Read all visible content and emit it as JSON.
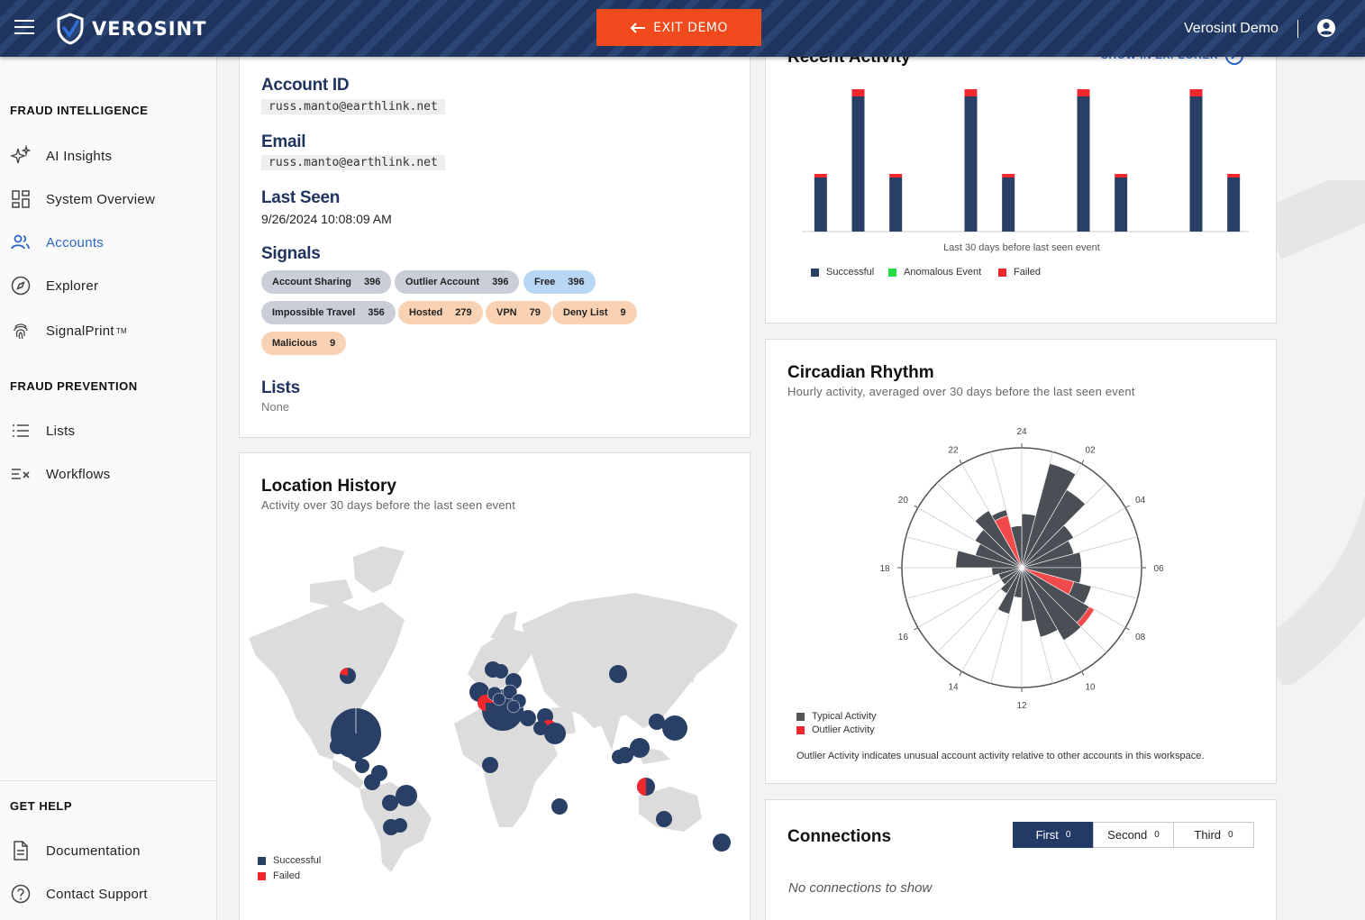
{
  "header": {
    "brand": "VEROSINT",
    "exit_label": "EXIT DEMO",
    "user_name": "Verosint Demo"
  },
  "sidebar": {
    "section_intel": "FRAUD INTELLIGENCE",
    "section_prevention": "FRAUD PREVENTION",
    "section_help": "GET HELP",
    "items": {
      "ai_insights": "AI Insights",
      "system_overview": "System Overview",
      "accounts": "Accounts",
      "explorer": "Explorer",
      "signalprint": "SignalPrint",
      "lists": "Lists",
      "workflows": "Workflows",
      "documentation": "Documentation",
      "contact_support": "Contact Support"
    },
    "trademark": "TM"
  },
  "account": {
    "account_id_label": "Account ID",
    "account_id": "russ.manto@earthlink.net",
    "email_label": "Email",
    "email": "russ.manto@earthlink.net",
    "last_seen_label": "Last Seen",
    "last_seen": "9/26/2024 10:08:09 AM",
    "signals_label": "Signals",
    "signals": [
      {
        "name": "Account Sharing",
        "count": "396"
      },
      {
        "name": "Outlier Account",
        "count": "396"
      },
      {
        "name": "Free",
        "count": "396"
      },
      {
        "name": "Impossible Travel",
        "count": "356"
      },
      {
        "name": "Hosted",
        "count": "279"
      },
      {
        "name": "VPN",
        "count": "79"
      },
      {
        "name": "Deny List",
        "count": "9"
      },
      {
        "name": "Malicious",
        "count": "9"
      }
    ],
    "lists_label": "Lists",
    "lists_value": "None"
  },
  "location": {
    "title": "Location History",
    "subtitle": "Activity over 30 days before the last seen event",
    "legend_successful": "Successful",
    "legend_failed": "Failed"
  },
  "recent": {
    "title": "Recent Activity",
    "link": "SHOW IN EXPLORER",
    "xlabel": "Last 30 days before last seen event",
    "legend": [
      "Successful",
      "Anomalous Event",
      "Failed"
    ]
  },
  "circadian": {
    "title": "Circadian Rhythm",
    "subtitle": "Hourly activity, averaged over 30 days before the last seen event",
    "legend_typical": "Typical Activity",
    "legend_outlier": "Outlier Activity",
    "note": "Outlier Activity indicates unusual account activity relative to other accounts in this workspace.",
    "hour_labels": [
      "24",
      "02",
      "04",
      "06",
      "08",
      "10",
      "12",
      "14",
      "16",
      "18",
      "20",
      "22"
    ]
  },
  "connections": {
    "title": "Connections",
    "tabs": [
      {
        "label": "First",
        "count": "0"
      },
      {
        "label": "Second",
        "count": "0"
      },
      {
        "label": "Third",
        "count": "0"
      }
    ],
    "empty": "No connections to show"
  },
  "colors": {
    "navy": "#2a3f66",
    "failed": "#f0282e",
    "anomalous": "#22dd44",
    "accent": "#f04a1d",
    "active_link": "#2a66c4"
  },
  "chart_data": [
    {
      "type": "bar",
      "stacked": true,
      "xlabel": "Last 30 days before last seen event",
      "categories": [
        "",
        "",
        "",
        "",
        "",
        "",
        "",
        "",
        "",
        "",
        "",
        ""
      ],
      "series": [
        {
          "name": "Successful",
          "values": [
            60,
            150,
            60,
            0,
            150,
            60,
            0,
            150,
            60,
            0,
            150,
            60
          ]
        },
        {
          "name": "Anomalous Event",
          "values": [
            0,
            0,
            0,
            0,
            0,
            0,
            0,
            0,
            0,
            0,
            0,
            0
          ]
        },
        {
          "name": "Failed",
          "values": [
            4,
            8,
            4,
            0,
            8,
            4,
            0,
            8,
            4,
            0,
            8,
            4
          ]
        }
      ],
      "legend": "bottom-left"
    },
    {
      "type": "polar-bar",
      "categories": [
        "00",
        "01",
        "02",
        "03",
        "04",
        "05",
        "06",
        "07",
        "08",
        "09",
        "10",
        "11",
        "12",
        "13",
        "14",
        "15",
        "16",
        "17",
        "18",
        "19",
        "20",
        "21",
        "22",
        "23"
      ],
      "series": [
        {
          "name": "Typical Activity",
          "values": [
            0.45,
            0.9,
            0.75,
            0.5,
            0.45,
            0.5,
            0.5,
            0.6,
            0.65,
            0.7,
            0.6,
            0.45,
            0.25,
            0.4,
            0.25,
            0.2,
            0.2,
            0.25,
            0.55,
            0.4,
            0.45,
            0.55,
            0.5,
            0.35
          ]
        },
        {
          "name": "Outlier Activity",
          "values": [
            0,
            0,
            0,
            0,
            0,
            0,
            0,
            0.45,
            0.7,
            0,
            0,
            0,
            0.25,
            0,
            0,
            0,
            0,
            0,
            0,
            0,
            0.45,
            0,
            0.45,
            0
          ]
        }
      ]
    }
  ]
}
